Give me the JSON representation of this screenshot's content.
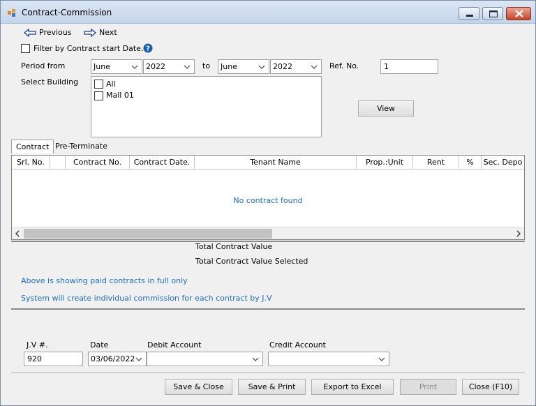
{
  "window": {
    "title": "Contract-Commission"
  },
  "nav": {
    "previous": "Previous",
    "next": "Next"
  },
  "filter": {
    "label": "Filter by Contract start Date.",
    "checked": false
  },
  "period": {
    "label": "Period from",
    "from_month": "June",
    "from_year": "2022",
    "to_label": "to",
    "to_month": "June",
    "to_year": "2022"
  },
  "ref": {
    "label": "Ref. No.",
    "value": "1"
  },
  "building": {
    "label": "Select Building",
    "items": [
      "All",
      "Mall 01"
    ]
  },
  "view_button": "View",
  "tabs": [
    "Contract",
    "Pre-Terminate"
  ],
  "grid": {
    "columns": [
      "Srl. No.",
      "",
      "Contract No.",
      "Contract Date.",
      "Tenant Name",
      "Prop.:Unit",
      "Rent",
      "%",
      "Sec. Depo"
    ],
    "empty_message": "No contract found"
  },
  "totals": {
    "value_label": "Total Contract Value",
    "selected_label": "Total Contract Value Selected"
  },
  "notes": [
    "Above is showing paid contracts in full only",
    "System will create individual commission for each contract  by J.V"
  ],
  "jv": {
    "label": "J.V #.",
    "value": "920",
    "date_label": "Date",
    "date_value": "03/06/2022",
    "debit_label": "Debit Account",
    "debit_value": "",
    "credit_label": "Credit Account",
    "credit_value": ""
  },
  "buttons": {
    "save_close": "Save & Close",
    "save_print": "Save & Print",
    "export": "Export to Excel",
    "print": "Print",
    "close": "Close (F10)"
  },
  "colors": {
    "info_text": "#1a6fc4",
    "help_icon": "#1a5fb4",
    "nav_arrow": "#1d3f8f"
  }
}
